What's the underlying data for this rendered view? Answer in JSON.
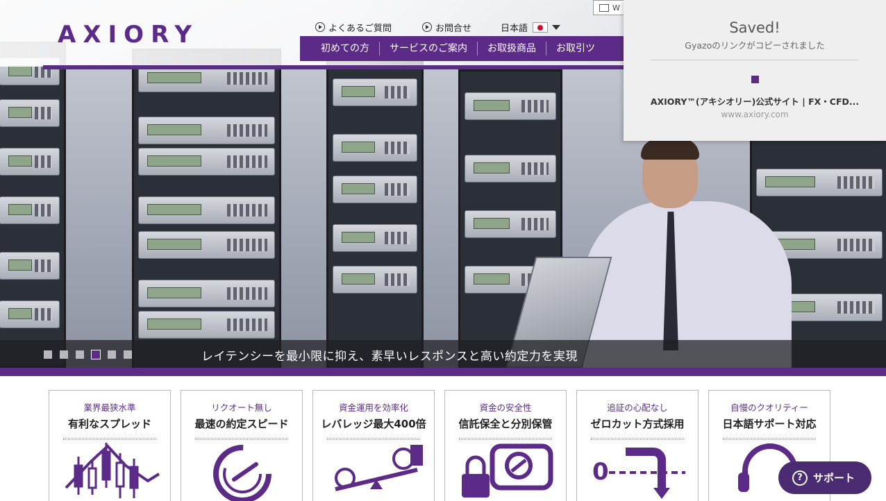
{
  "brand": {
    "logo": "AXIORY",
    "accent": "#5b2b87"
  },
  "header": {
    "top_links": [
      "よくあるご質問",
      "お問合せ"
    ],
    "language": "日本語",
    "w_button": "W",
    "nav": [
      "初めての方",
      "サービスのご案内",
      "お取扱商品",
      "お取引ツ"
    ]
  },
  "hero": {
    "caption": "レイテンシーを最小限に抑え、素早いレスポンスと高い約定力を実現",
    "slides": 6,
    "active_slide": 4
  },
  "gyazo": {
    "saved": "Saved!",
    "sub": "Gyazoのリンクがコピーされました",
    "page_title": "AXIORY™(アキシオリー)公式サイト | FX・CFD...",
    "page_url": "www.axiory.com"
  },
  "features": [
    {
      "tag": "業界最狭水準",
      "title": "有利なスプレッド",
      "icon": "candlestick-chart-icon"
    },
    {
      "tag": "リクオート無し",
      "title": "最速の約定スピード",
      "icon": "speedometer-icon"
    },
    {
      "tag": "資金運用を効率化",
      "title": "レバレッジ最大400倍",
      "icon": "seesaw-coins-icon"
    },
    {
      "tag": "資金の安全性",
      "title": "信託保全と分別保管",
      "icon": "safe-lock-icon"
    },
    {
      "tag": "追証の心配なし",
      "title": "ゼロカット方式採用",
      "icon": "zero-cut-icon"
    },
    {
      "tag": "自慢のクオリティー",
      "title": "日本語サポート対応",
      "icon": "headset-icon"
    }
  ],
  "support": {
    "label": "サポート",
    "icon": "question-icon"
  }
}
